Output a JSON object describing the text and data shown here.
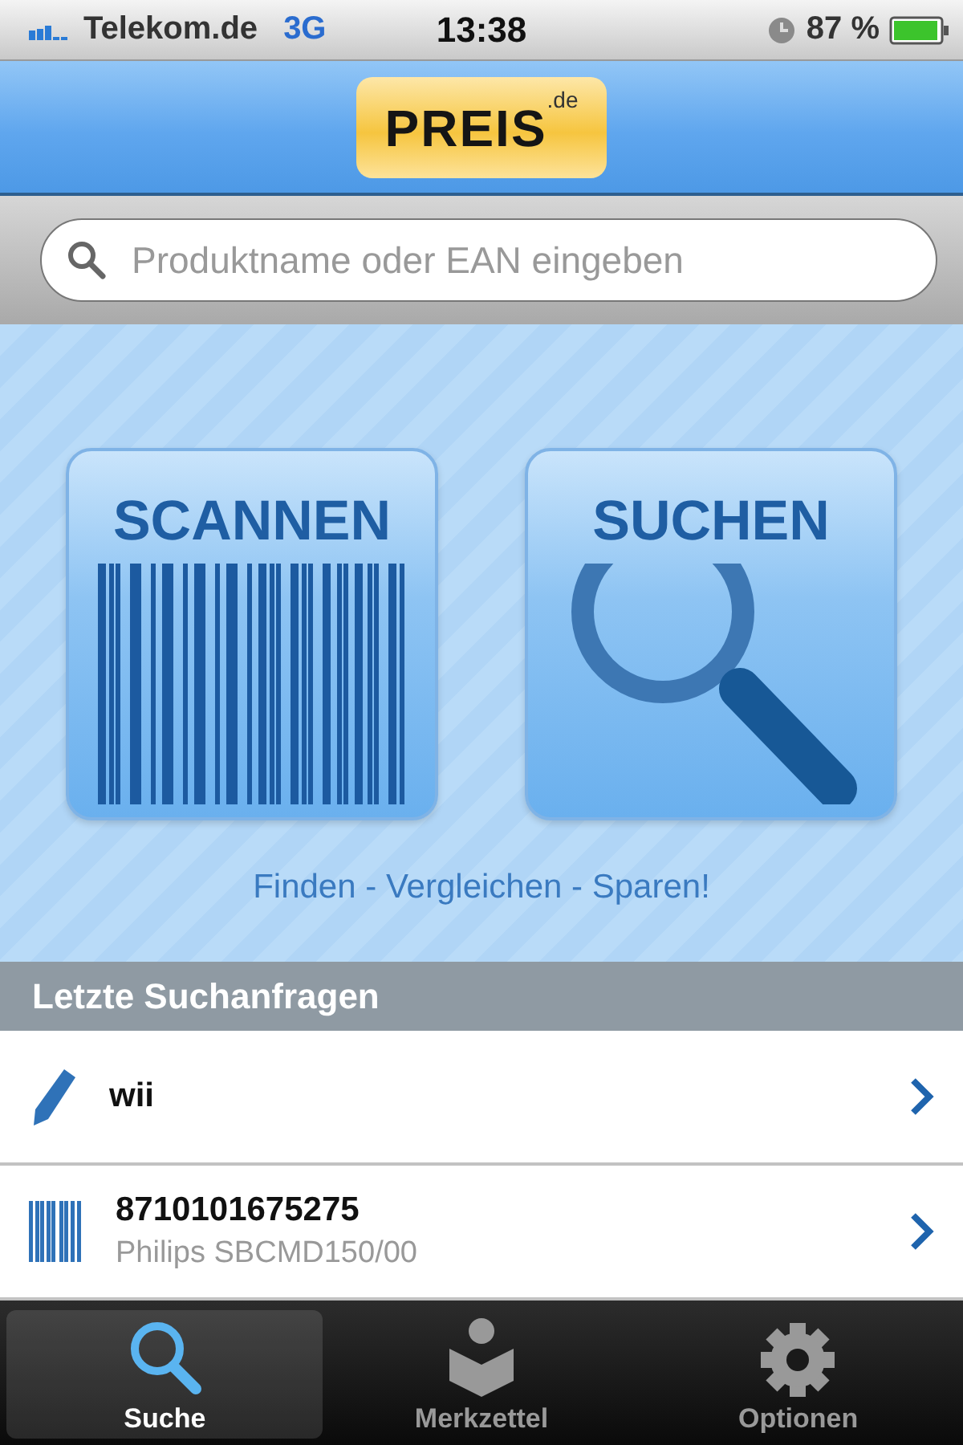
{
  "status_bar": {
    "carrier": "Telekom.de",
    "network": "3G",
    "time": "13:38",
    "battery": "87 %"
  },
  "logo": {
    "main": "PREIS",
    "suffix": ".de"
  },
  "search": {
    "placeholder": "Produktname oder EAN eingeben"
  },
  "actions": [
    {
      "kind": "scan",
      "label": "SCANNEN"
    },
    {
      "kind": "search",
      "label": "SUCHEN"
    }
  ],
  "slogan": "Finden - Vergleichen - Sparen!",
  "recent": {
    "title": "Letzte Suchanfragen",
    "items": [
      {
        "kind": "text",
        "title": "wii"
      },
      {
        "kind": "barcode",
        "title": "8710101675275",
        "subtitle": "Philips SBCMD150/00"
      }
    ]
  },
  "tabs": [
    {
      "kind": "search",
      "label": "Suche",
      "selected": true
    },
    {
      "kind": "reader",
      "label": "Merkzettel",
      "selected": false
    },
    {
      "kind": "gear",
      "label": "Optionen",
      "selected": false
    }
  ]
}
